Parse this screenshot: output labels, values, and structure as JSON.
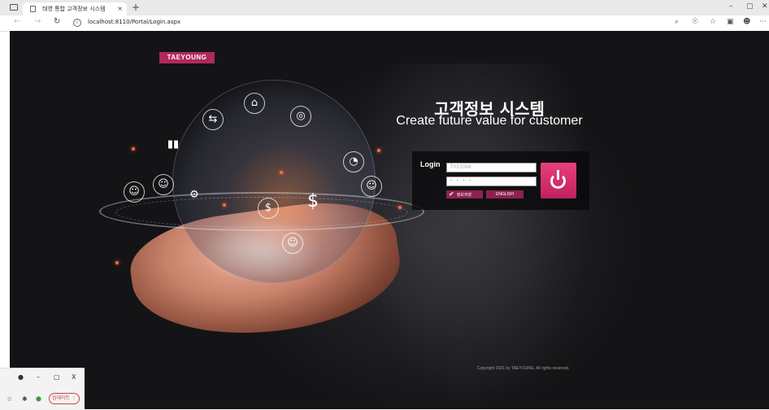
{
  "browser": {
    "tab_title": "태영 통합 고객정보 시스템",
    "tab_close": "×",
    "new_tab": "+",
    "url": "localhost:8110/Portal/Login.aspx",
    "win_min": "–",
    "win_max": "▢",
    "win_close": "✕",
    "more": "···"
  },
  "page": {
    "logo": "TAEYOUNG",
    "title": "고객정보 시스템",
    "subtitle": "Create future value for customer",
    "login": {
      "label": "Login",
      "user_placeholder": "TYC1004",
      "password_masked": "• • • •",
      "remember_label": "정보저장",
      "language_label": "ENGLISH"
    },
    "copyright": "Copyright 2021 by TAEYOUNG, All rights reserved."
  },
  "mini_window": {
    "min": "–",
    "restore": "▢",
    "close": "X",
    "update_label": "업데이트"
  },
  "colors": {
    "brand": "#b0285e",
    "power_button": "#d8306c"
  }
}
